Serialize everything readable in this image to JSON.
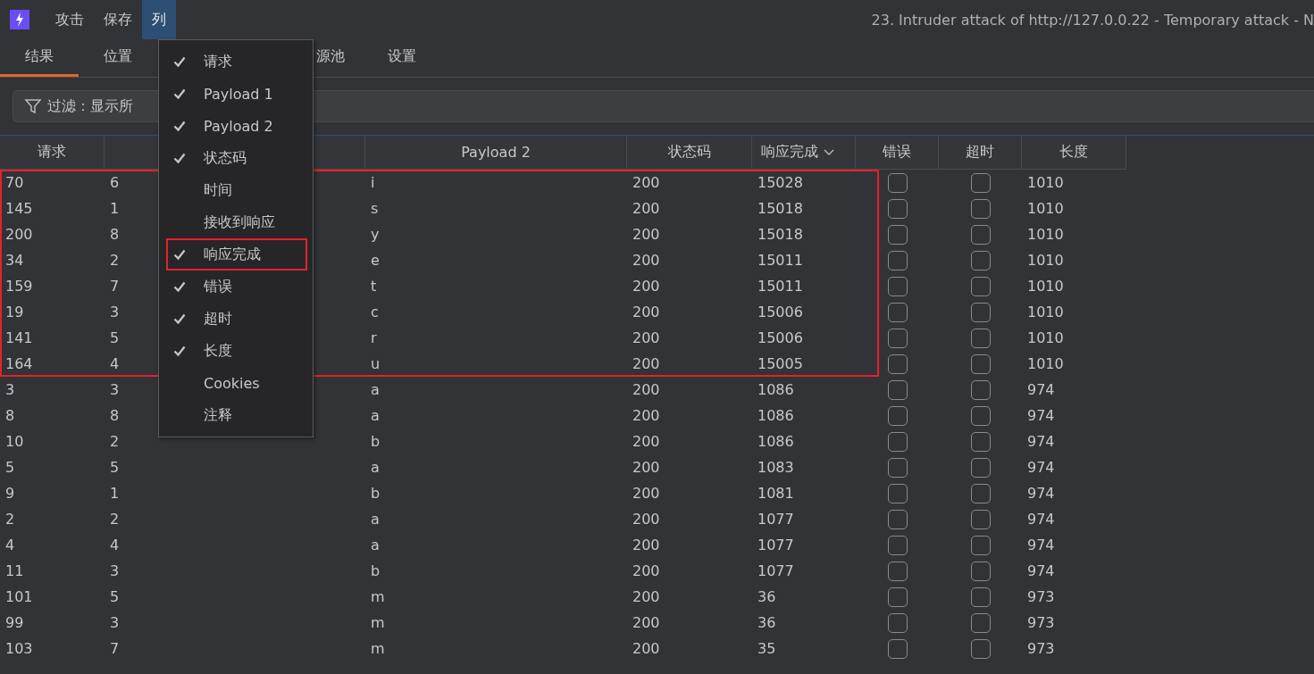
{
  "menubar": {
    "items": [
      {
        "label": "攻击",
        "selected": false
      },
      {
        "label": "保存",
        "selected": false
      },
      {
        "label": "列",
        "selected": true
      }
    ],
    "title": "23. Intruder attack of http://127.0.0.22 - Temporary attack - N"
  },
  "tabs": [
    {
      "label": "结果",
      "selected": true
    },
    {
      "label": "位置",
      "selected": false
    },
    {
      "label": "源池",
      "selected": false
    },
    {
      "label": "设置",
      "selected": false
    }
  ],
  "filter": {
    "value": "过滤：显示所"
  },
  "table": {
    "columns": [
      {
        "label": "请求"
      },
      {},
      {
        "label": "Payload 2"
      },
      {
        "label": "状态码"
      },
      {
        "label": "响应完成",
        "sorted": true
      },
      {
        "label": "错误"
      },
      {
        "label": "超时"
      },
      {
        "label": "长度"
      }
    ],
    "rows": [
      {
        "request": "70",
        "payload1": "6",
        "payload2": "i",
        "status": "200",
        "response_completed": "15028",
        "error": false,
        "timeout": false,
        "length": "1010",
        "highlighted": true
      },
      {
        "request": "145",
        "payload1": "1",
        "payload2": "s",
        "status": "200",
        "response_completed": "15018",
        "error": false,
        "timeout": false,
        "length": "1010",
        "highlighted": true
      },
      {
        "request": "200",
        "payload1": "8",
        "payload2": "y",
        "status": "200",
        "response_completed": "15018",
        "error": false,
        "timeout": false,
        "length": "1010",
        "highlighted": true
      },
      {
        "request": "34",
        "payload1": "2",
        "payload2": "e",
        "status": "200",
        "response_completed": "15011",
        "error": false,
        "timeout": false,
        "length": "1010",
        "highlighted": true
      },
      {
        "request": "159",
        "payload1": "7",
        "payload2": "t",
        "status": "200",
        "response_completed": "15011",
        "error": false,
        "timeout": false,
        "length": "1010",
        "highlighted": true
      },
      {
        "request": "19",
        "payload1": "3",
        "payload2": "c",
        "status": "200",
        "response_completed": "15006",
        "error": false,
        "timeout": false,
        "length": "1010",
        "highlighted": true
      },
      {
        "request": "141",
        "payload1": "5",
        "payload2": "r",
        "status": "200",
        "response_completed": "15006",
        "error": false,
        "timeout": false,
        "length": "1010",
        "highlighted": true
      },
      {
        "request": "164",
        "payload1": "4",
        "payload2": "u",
        "status": "200",
        "response_completed": "15005",
        "error": false,
        "timeout": false,
        "length": "1010",
        "highlighted": true
      },
      {
        "request": "3",
        "payload1": "3",
        "payload2": "a",
        "status": "200",
        "response_completed": "1086",
        "error": false,
        "timeout": false,
        "length": "974",
        "highlighted": false
      },
      {
        "request": "8",
        "payload1": "8",
        "payload2": "a",
        "status": "200",
        "response_completed": "1086",
        "error": false,
        "timeout": false,
        "length": "974",
        "highlighted": false
      },
      {
        "request": "10",
        "payload1": "2",
        "payload2": "b",
        "status": "200",
        "response_completed": "1086",
        "error": false,
        "timeout": false,
        "length": "974",
        "highlighted": false
      },
      {
        "request": "5",
        "payload1": "5",
        "payload2": "a",
        "status": "200",
        "response_completed": "1083",
        "error": false,
        "timeout": false,
        "length": "974",
        "highlighted": false
      },
      {
        "request": "9",
        "payload1": "1",
        "payload2": "b",
        "status": "200",
        "response_completed": "1081",
        "error": false,
        "timeout": false,
        "length": "974",
        "highlighted": false
      },
      {
        "request": "2",
        "payload1": "2",
        "payload2": "a",
        "status": "200",
        "response_completed": "1077",
        "error": false,
        "timeout": false,
        "length": "974",
        "highlighted": false
      },
      {
        "request": "4",
        "payload1": "4",
        "payload2": "a",
        "status": "200",
        "response_completed": "1077",
        "error": false,
        "timeout": false,
        "length": "974",
        "highlighted": false
      },
      {
        "request": "11",
        "payload1": "3",
        "payload2": "b",
        "status": "200",
        "response_completed": "1077",
        "error": false,
        "timeout": false,
        "length": "974",
        "highlighted": false
      },
      {
        "request": "101",
        "payload1": "5",
        "payload2": "m",
        "status": "200",
        "response_completed": "36",
        "error": false,
        "timeout": false,
        "length": "973",
        "highlighted": false
      },
      {
        "request": "99",
        "payload1": "3",
        "payload2": "m",
        "status": "200",
        "response_completed": "36",
        "error": false,
        "timeout": false,
        "length": "973",
        "highlighted": false
      },
      {
        "request": "103",
        "payload1": "7",
        "payload2": "m",
        "status": "200",
        "response_completed": "35",
        "error": false,
        "timeout": false,
        "length": "973",
        "highlighted": false
      }
    ]
  },
  "column_menu": {
    "items": [
      {
        "label": "请求",
        "checked": true,
        "highlighted": false
      },
      {
        "label": "Payload 1",
        "checked": true,
        "highlighted": false
      },
      {
        "label": "Payload 2",
        "checked": true,
        "highlighted": false
      },
      {
        "label": "状态码",
        "checked": true,
        "highlighted": false
      },
      {
        "label": "时间",
        "checked": false,
        "highlighted": false
      },
      {
        "label": "接收到响应",
        "checked": false,
        "highlighted": false
      },
      {
        "label": "响应完成",
        "checked": true,
        "highlighted": true
      },
      {
        "label": "错误",
        "checked": true,
        "highlighted": false
      },
      {
        "label": "超时",
        "checked": true,
        "highlighted": false
      },
      {
        "label": "长度",
        "checked": true,
        "highlighted": false
      },
      {
        "label": "Cookies",
        "checked": false,
        "highlighted": false
      },
      {
        "label": "注释",
        "checked": false,
        "highlighted": false
      }
    ]
  }
}
